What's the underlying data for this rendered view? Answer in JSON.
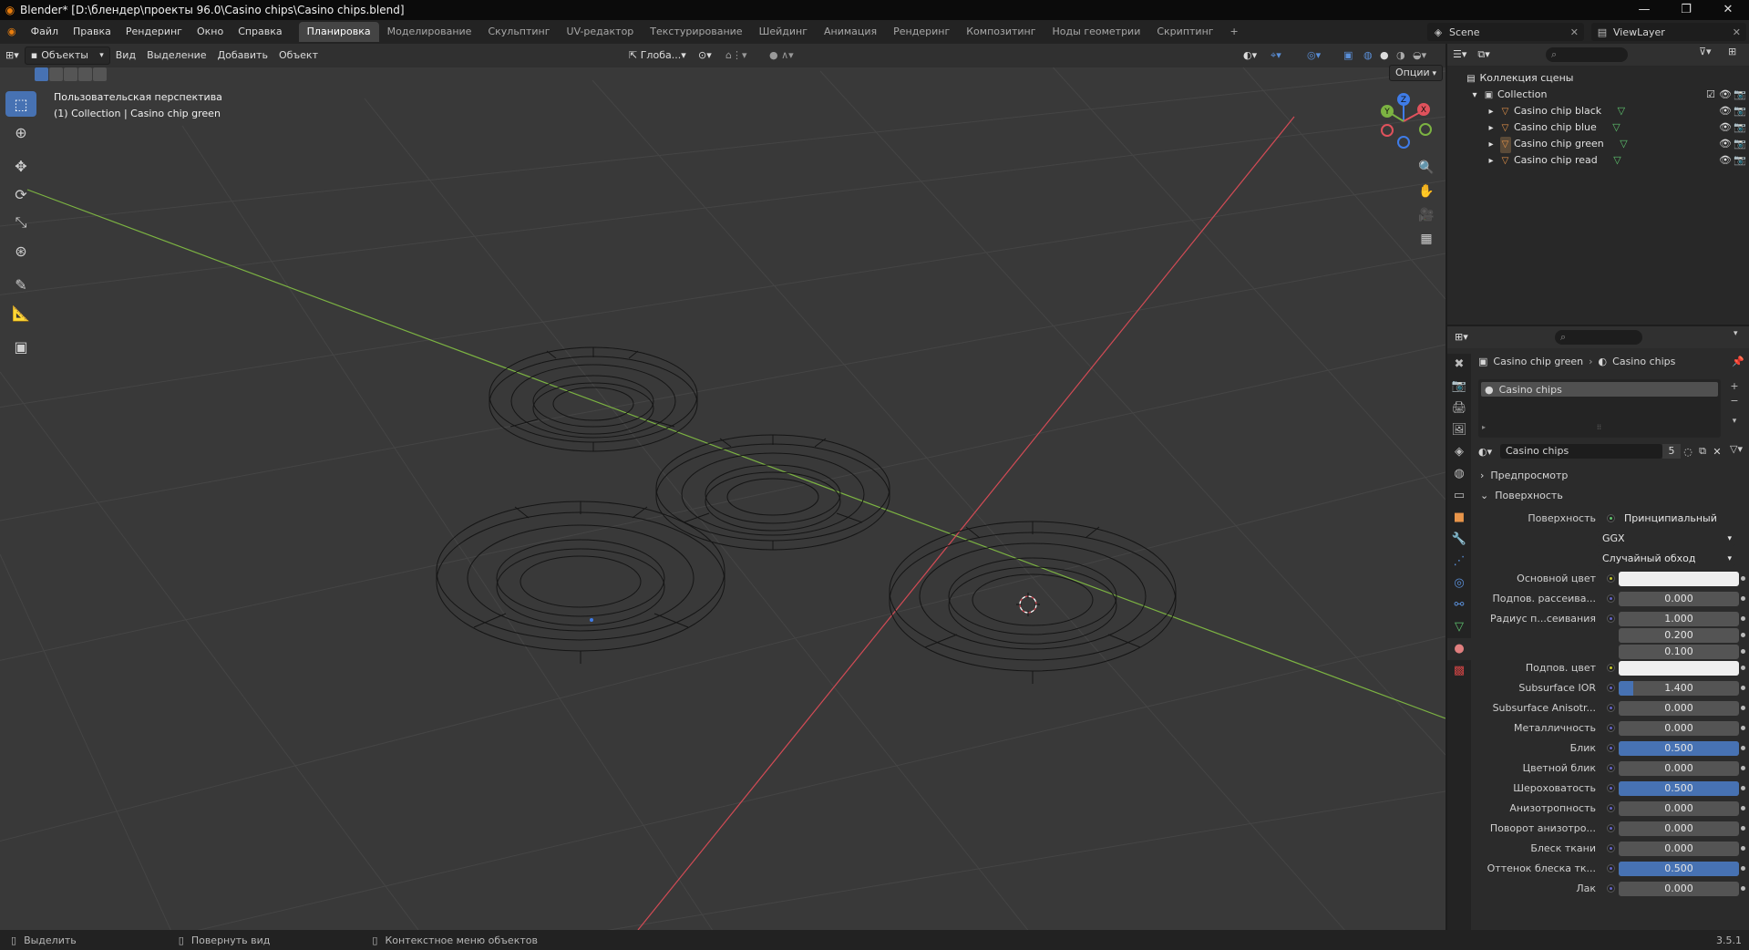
{
  "window": {
    "title": "Blender* [D:\\блендер\\проекты 96.0\\Casino chips\\Casino chips.blend]",
    "controls": [
      "—",
      "❐",
      "✕"
    ]
  },
  "menu": [
    "Файл",
    "Правка",
    "Рендеринг",
    "Окно",
    "Справка"
  ],
  "workspaces": [
    "Планировка",
    "Моделирование",
    "Скульптинг",
    "UV-редактор",
    "Текстурирование",
    "Шейдинг",
    "Анимация",
    "Рендеринг",
    "Композитинг",
    "Ноды геометрии",
    "Скриптинг"
  ],
  "active_workspace": "Планировка",
  "scene": {
    "scene_name": "Scene",
    "view_layer": "ViewLayer"
  },
  "viewport": {
    "mode": "Объекты",
    "menus": [
      "Вид",
      "Выделение",
      "Добавить",
      "Объект"
    ],
    "transform_orientation": "Глоба...",
    "options_label": "Опции",
    "perspective_label": "Пользовательская перспектива",
    "collection_label": "(1) Collection | Casino chip green",
    "gizmo_axes": [
      "X",
      "Y",
      "Z"
    ]
  },
  "outliner": {
    "scene_collection": "Коллекция сцены",
    "collection": "Collection",
    "objects": [
      "Casino chip black",
      "Casino chip blue",
      "Casino chip green",
      "Casino chip read"
    ],
    "selected": "Casino chip green"
  },
  "properties": {
    "breadcrumb_object": "Casino chip green",
    "breadcrumb_material": "Casino chips",
    "slot_name": "Casino chips",
    "material_name": "Casino chips",
    "user_count": "5",
    "panel_preview": "Предпросмотр",
    "panel_surface": "Поверхность",
    "surface_label": "Поверхность",
    "surface_value": "Принципиальный BSDF",
    "distribution": "GGX",
    "subsurface_method": "Случайный обход",
    "rows": [
      {
        "label": "Основной цвет",
        "value": "",
        "kind": "color",
        "fill": 0
      },
      {
        "label": "Подпов. рассеива...",
        "value": "0.000",
        "kind": "num",
        "fill": 0
      },
      {
        "label": "Радиус п...сеивания",
        "value": "1.000",
        "kind": "num",
        "fill": 0
      },
      {
        "label": "",
        "value": "0.200",
        "kind": "num",
        "fill": 0
      },
      {
        "label": "",
        "value": "0.100",
        "kind": "num",
        "fill": 0
      },
      {
        "label": "Подпов. цвет",
        "value": "",
        "kind": "color",
        "fill": 0
      },
      {
        "label": "Subsurface IOR",
        "value": "1.400",
        "kind": "num",
        "fill": 0.12
      },
      {
        "label": "Subsurface Anisotr...",
        "value": "0.000",
        "kind": "num",
        "fill": 0
      },
      {
        "label": "Металличность",
        "value": "0.000",
        "kind": "num",
        "fill": 0
      },
      {
        "label": "Блик",
        "value": "0.500",
        "kind": "num",
        "fill": 1
      },
      {
        "label": "Цветной блик",
        "value": "0.000",
        "kind": "num",
        "fill": 0
      },
      {
        "label": "Шероховатость",
        "value": "0.500",
        "kind": "num",
        "fill": 1
      },
      {
        "label": "Анизотропность",
        "value": "0.000",
        "kind": "num",
        "fill": 0
      },
      {
        "label": "Поворот анизотро...",
        "value": "0.000",
        "kind": "num",
        "fill": 0
      },
      {
        "label": "Блеск ткани",
        "value": "0.000",
        "kind": "num",
        "fill": 0
      },
      {
        "label": "Оттенок блеска тк...",
        "value": "0.500",
        "kind": "num",
        "fill": 1
      },
      {
        "label": "Лак",
        "value": "0.000",
        "kind": "num",
        "fill": 0
      }
    ]
  },
  "status": {
    "select": "Выделить",
    "rotate": "Повернуть вид",
    "context": "Контекстное меню объектов",
    "version": "3.5.1"
  },
  "colors": {
    "accent": "#4772b3",
    "x_axis": "#e0525c",
    "y_axis": "#7cb342",
    "z_axis": "#3f7ce8",
    "object_icon": "#e8954a"
  }
}
